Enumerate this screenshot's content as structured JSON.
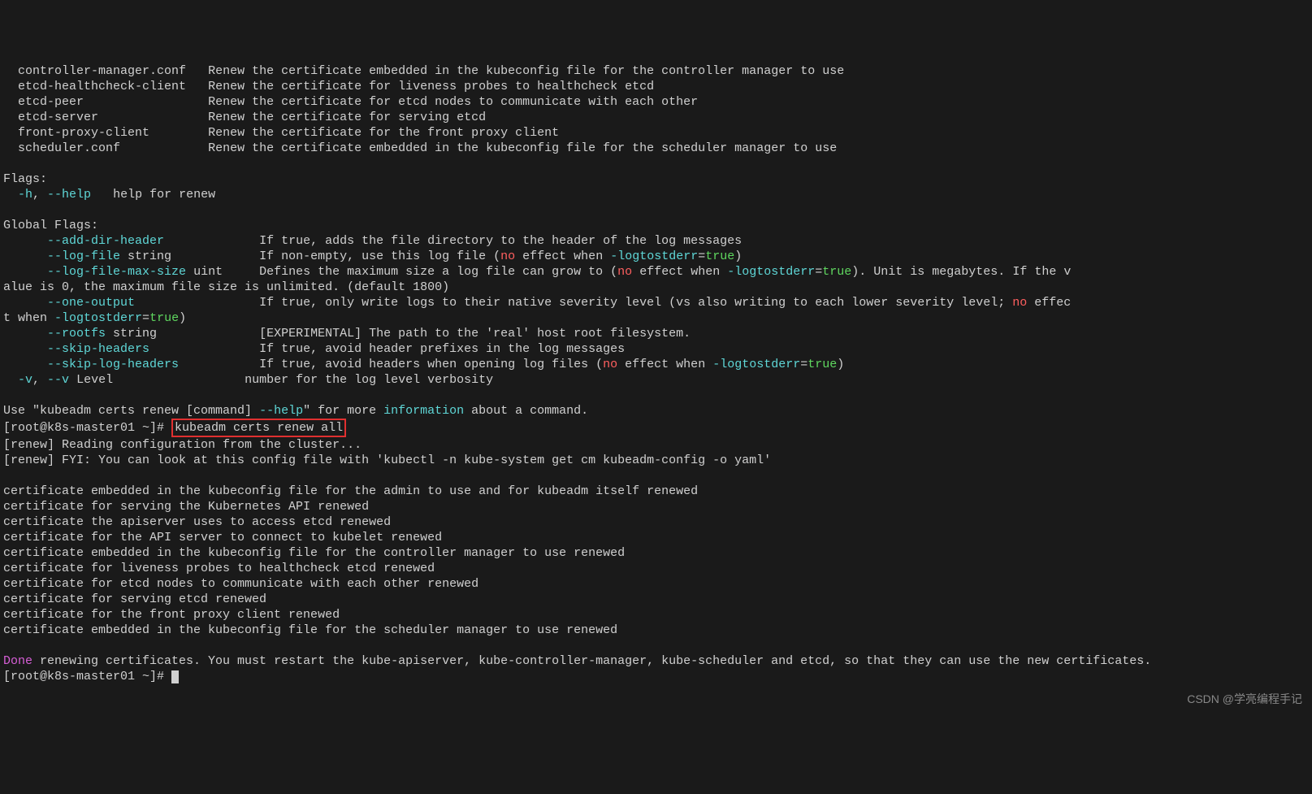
{
  "subcommands": [
    {
      "name": "controller-manager.conf",
      "desc": "Renew the certificate embedded in the kubeconfig file for the controller manager to use"
    },
    {
      "name": "etcd-healthcheck-client",
      "desc": "Renew the certificate for liveness probes to healthcheck etcd"
    },
    {
      "name": "etcd-peer",
      "desc": "Renew the certificate for etcd nodes to communicate with each other"
    },
    {
      "name": "etcd-server",
      "desc": "Renew the certificate for serving etcd"
    },
    {
      "name": "front-proxy-client",
      "desc": "Renew the certificate for the front proxy client"
    },
    {
      "name": "scheduler.conf",
      "desc": "Renew the certificate embedded in the kubeconfig file for the scheduler manager to use"
    }
  ],
  "flags_header": "Flags:",
  "flags_help_short": "-h",
  "flags_help_long": "--help",
  "flags_help_desc": "help for renew",
  "global_flags_header": "Global Flags:",
  "gf": {
    "add_dir_header": {
      "flag": "--add-dir-header",
      "desc": "If true, adds the file directory to the header of the log messages"
    },
    "log_file": {
      "flag": "--log-file",
      "arg": "string",
      "desc_pre": "If non-empty, use this log file (",
      "no": "no",
      "desc_mid": " effect when ",
      "opt": "-logtostderr",
      "eq": "=",
      "val": "true",
      "desc_post": ")"
    },
    "log_file_max_size": {
      "flag": "--log-file-max-size",
      "arg": "uint",
      "desc_pre": "Defines the maximum size a log file can grow to (",
      "no": "no",
      "desc_mid": " effect when ",
      "opt": "-logtostderr",
      "eq": "=",
      "val": "true",
      "desc_post": "). Unit is megabytes. If the v"
    },
    "log_file_max_size_cont": "alue is 0, the maximum file size is unlimited. (default 1800)",
    "one_output": {
      "flag": "--one-output",
      "desc_pre": "If true, only write logs to their native severity level (vs also writing to each lower severity level; ",
      "no": "no",
      "desc_post": " effec"
    },
    "one_output_cont_pre": "t when ",
    "one_output_cont_opt": "-logtostderr",
    "one_output_cont_eq": "=",
    "one_output_cont_val": "true",
    "one_output_cont_post": ")",
    "rootfs": {
      "flag": "--rootfs",
      "arg": "string",
      "desc": "[EXPERIMENTAL] The path to the 'real' host root filesystem."
    },
    "skip_headers": {
      "flag": "--skip-headers",
      "desc": "If true, avoid header prefixes in the log messages"
    },
    "skip_log_headers": {
      "flag": "--skip-log-headers",
      "desc_pre": "If true, avoid headers when opening log files (",
      "no": "no",
      "desc_mid": " effect when ",
      "opt": "-logtostderr",
      "eq": "=",
      "val": "true",
      "desc_post": ")"
    },
    "v": {
      "short": "-v",
      "long": "--v",
      "arg": "Level",
      "desc": "number for the log level verbosity"
    }
  },
  "use_line_pre": "Use \"kubeadm certs renew [command] ",
  "use_line_help": "--help",
  "use_line_mid": "\" for more ",
  "use_line_info": "information",
  "use_line_post": " about a command.",
  "prompt1": "[root@k8s-master01 ~]# ",
  "cmd1": "kubeadm certs renew all",
  "renew_reading": "[renew] Reading configuration from the cluster...",
  "renew_fyi": "[renew] FYI: You can look at this config file with 'kubectl -n kube-system get cm kubeadm-config -o yaml'",
  "cert_lines": [
    "certificate embedded in the kubeconfig file for the admin to use and for kubeadm itself renewed",
    "certificate for serving the Kubernetes API renewed",
    "certificate the apiserver uses to access etcd renewed",
    "certificate for the API server to connect to kubelet renewed",
    "certificate embedded in the kubeconfig file for the controller manager to use renewed",
    "certificate for liveness probes to healthcheck etcd renewed",
    "certificate for etcd nodes to communicate with each other renewed",
    "certificate for serving etcd renewed",
    "certificate for the front proxy client renewed",
    "certificate embedded in the kubeconfig file for the scheduler manager to use renewed"
  ],
  "done_word": "Done",
  "done_rest": " renewing certificates. You must restart the kube-apiserver, kube-controller-manager, kube-scheduler and etcd, so that they can use the new certificates.",
  "prompt2": "[root@k8s-master01 ~]# ",
  "watermark": "CSDN @学亮编程手记"
}
